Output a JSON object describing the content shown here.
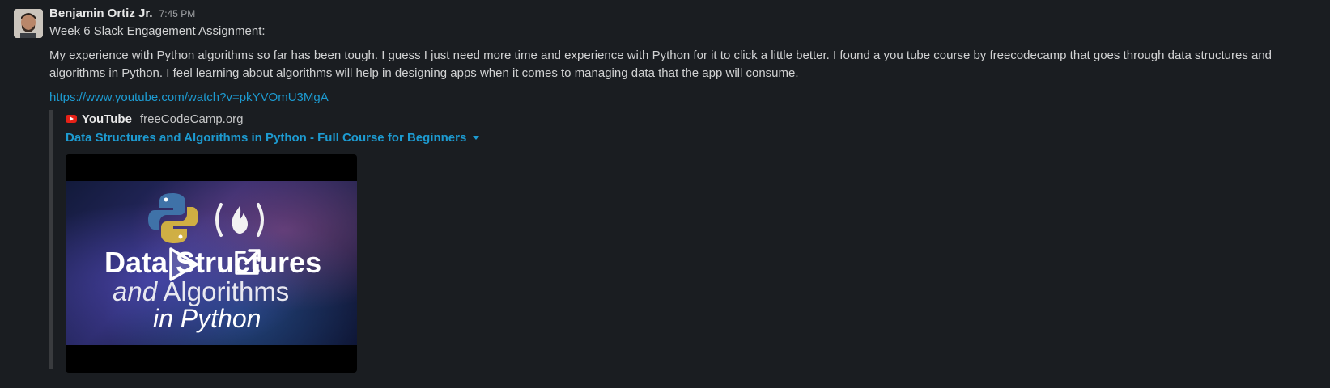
{
  "message": {
    "author": "Benjamin Ortiz Jr.",
    "timestamp": "7:45 PM",
    "line1": "Week 6 Slack Engagement Assignment:",
    "paragraph": "My experience with Python algorithms so far has been tough. I guess I just need more time and experience with Python for it to click a little better. I found a you tube course by freecodecamp that goes through data structures and algorithms in Python. I feel learning about algorithms will help in designing apps when it comes to managing data that the app will consume.",
    "link": "https://www.youtube.com/watch?v=pkYVOmU3MgA"
  },
  "attachment": {
    "provider": "YouTube",
    "channel": "freeCodeCamp.org",
    "title": "Data Structures and Algorithms in Python - Full Course for Beginners",
    "thumbnail": {
      "line1": "Data Structures",
      "line2_italic": "and",
      "line2_rest": "Algorithms",
      "line3": "in Python"
    }
  },
  "colors": {
    "background": "#1a1d21",
    "link": "#1d9bd1",
    "youtube_red": "#e62117"
  },
  "icons": [
    "avatar",
    "youtube-icon",
    "caret-down-icon",
    "python-logo-icon",
    "freecodecamp-logo-icon",
    "play-icon",
    "external-link-icon"
  ]
}
